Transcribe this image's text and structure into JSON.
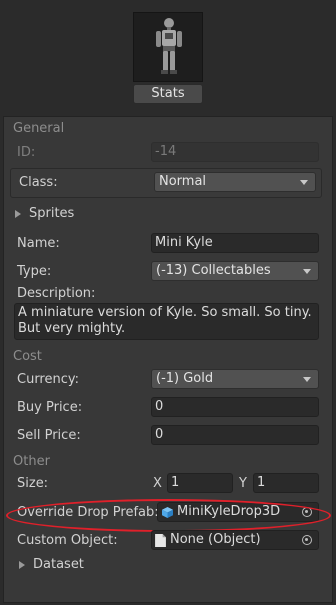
{
  "preview": {
    "button_label": "Stats"
  },
  "general": {
    "header": "General",
    "id_label": "ID:",
    "id_value": "-14",
    "class_label": "Class:",
    "class_value": "Normal"
  },
  "sprites": {
    "label": "Sprites"
  },
  "name": {
    "label": "Name:",
    "value": "Mini Kyle"
  },
  "type": {
    "label": "Type:",
    "value": "(-13) Collectables"
  },
  "description": {
    "label": "Description:",
    "value": "A miniature version of Kyle. So small. So tiny. But very mighty."
  },
  "cost": {
    "header": "Cost",
    "currency_label": "Currency:",
    "currency_value": "(-1) Gold",
    "buy_label": "Buy Price:",
    "buy_value": "0",
    "sell_label": "Sell Price:",
    "sell_value": "0"
  },
  "other": {
    "header": "Other",
    "size_label": "Size:",
    "x_label": "X",
    "x_value": "1",
    "y_label": "Y",
    "y_value": "1",
    "override_label": "Override Drop Prefab:",
    "override_value": "MiniKyleDrop3D",
    "custom_label": "Custom Object:",
    "custom_value": "None (Object)"
  },
  "dataset": {
    "label": "Dataset"
  },
  "colors": {
    "background": "#2b2b2b",
    "panel": "#383838",
    "highlight": "#e0202a",
    "prefab_icon": "#4fa8e8"
  }
}
